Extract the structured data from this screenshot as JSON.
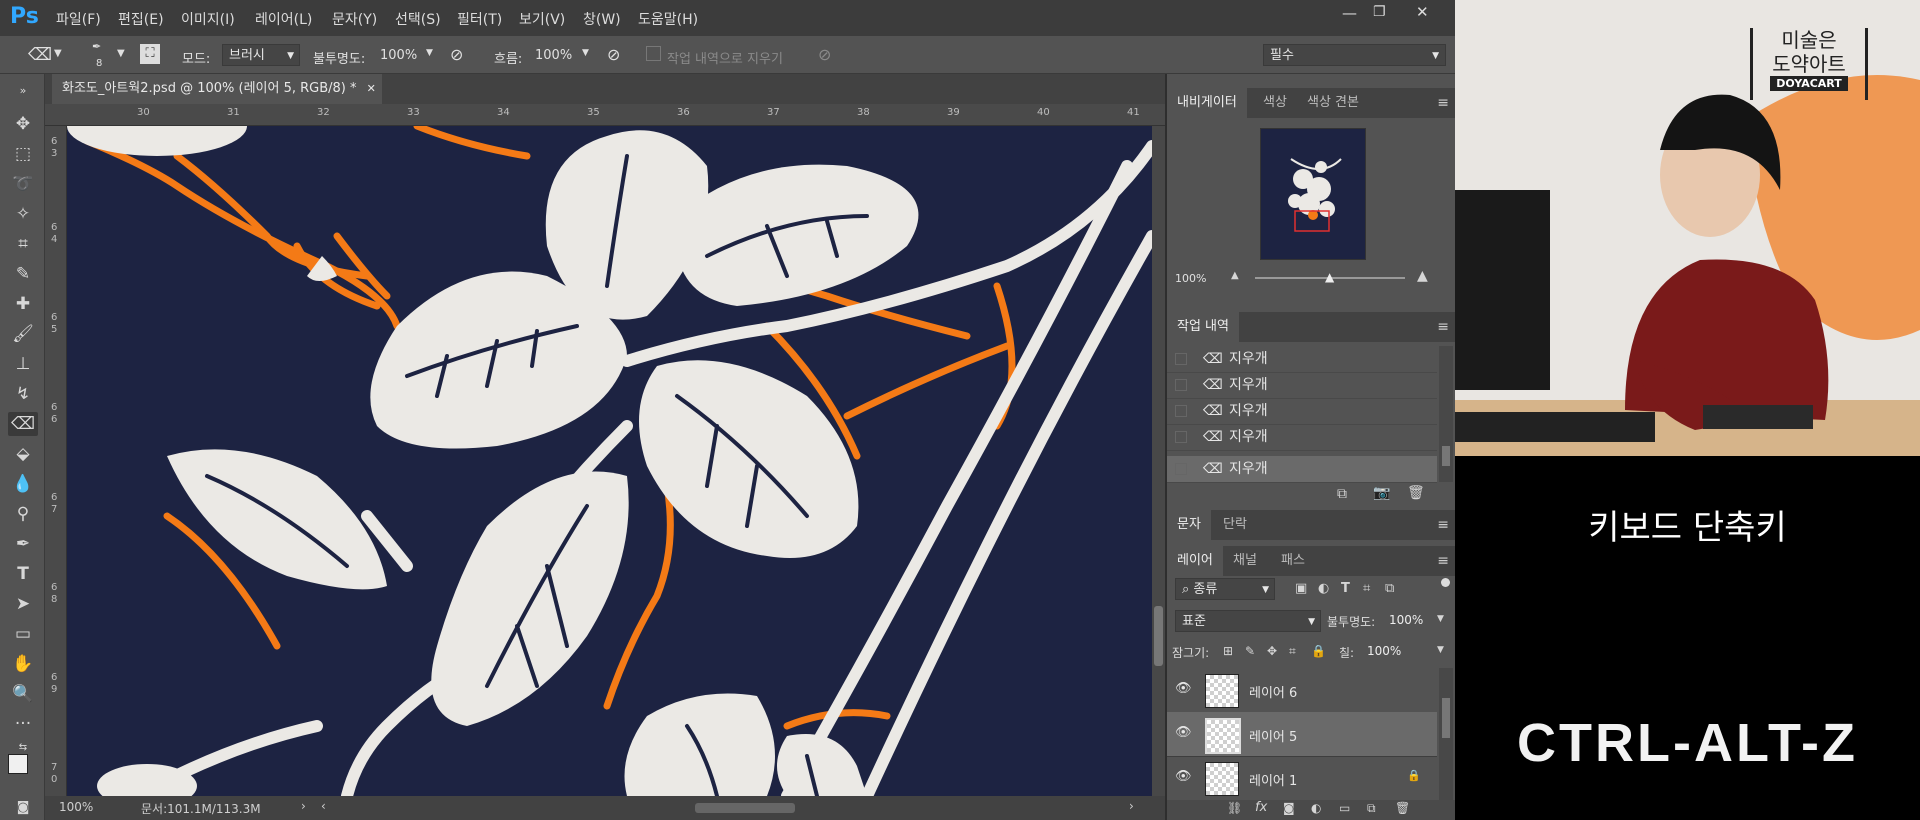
{
  "app": {
    "logo": "Ps",
    "menu": [
      "파일(F)",
      "편집(E)",
      "이미지(I)",
      "레이어(L)",
      "문자(Y)",
      "선택(S)",
      "필터(T)",
      "보기(V)",
      "창(W)",
      "도움말(H)"
    ],
    "window_controls": [
      "—",
      "❐",
      "✕"
    ]
  },
  "options": {
    "brush_size": "8",
    "mode_label": "모드:",
    "mode_value": "브러시",
    "opacity_label": "불투명도:",
    "opacity_value": "100%",
    "flow_label": "흐름:",
    "flow_value": "100%",
    "history_erase_label": "작업 내역으로 지우기",
    "workspace": "필수"
  },
  "document": {
    "tab_title": "화조도_아트웍2.psd @ 100% (레이어 5, RGB/8) *",
    "ruler_top": [
      "30",
      "31",
      "32",
      "33",
      "34",
      "35",
      "36",
      "37",
      "38",
      "39",
      "40",
      "41"
    ],
    "ruler_left": [
      "6",
      "3",
      "6",
      "4",
      "6",
      "5",
      "6",
      "6",
      "6",
      "7",
      "6",
      "8",
      "6",
      "9",
      "7",
      "0"
    ],
    "zoom": "100%",
    "doc_size": "문서:101.1M/113.3M"
  },
  "navigator": {
    "tabs": [
      "내비게이터",
      "색상",
      "색상 견본"
    ],
    "zoom": "100%"
  },
  "history": {
    "tab": "작업 내역",
    "items": [
      "지우개",
      "지우개",
      "지우개",
      "지우개",
      "지우개"
    ]
  },
  "char_panel": {
    "tabs": [
      "문자",
      "단락"
    ]
  },
  "layers": {
    "tabs": [
      "레이어",
      "채널",
      "패스"
    ],
    "filter_kind": "종류",
    "blend_mode": "표준",
    "opacity_label": "불투명도:",
    "opacity_value": "100%",
    "lock_label": "잠그기:",
    "fill_label": "칠:",
    "fill_value": "100%",
    "items": [
      "레이어 6",
      "레이어 5",
      "레이어 1"
    ]
  },
  "video": {
    "sign_line1": "미술은",
    "sign_line2": "도약아트",
    "sign_brand": "DOYACART",
    "caption": "키보드 단축키",
    "shortcut": "CTRL-ALT-Z"
  },
  "colors": {
    "canvas_bg": "#1d2342",
    "leaf": "#ebe9e5",
    "accent_orange": "#f47a16",
    "ps_blue": "#31a8ff",
    "panel_bg": "#535353"
  }
}
